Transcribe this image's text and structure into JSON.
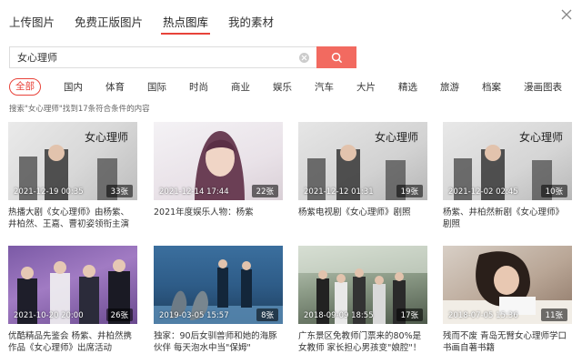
{
  "tabs": [
    {
      "label": "上传图片",
      "active": false
    },
    {
      "label": "免费正版图片",
      "active": false
    },
    {
      "label": "热点图库",
      "active": true
    },
    {
      "label": "我的素材",
      "active": false
    }
  ],
  "search": {
    "value": "女心理师"
  },
  "categories": [
    {
      "label": "全部",
      "active": true
    },
    {
      "label": "国内"
    },
    {
      "label": "体育"
    },
    {
      "label": "国际"
    },
    {
      "label": "时尚"
    },
    {
      "label": "商业"
    },
    {
      "label": "娱乐"
    },
    {
      "label": "汽车"
    },
    {
      "label": "大片"
    },
    {
      "label": "精选"
    },
    {
      "label": "旅游"
    },
    {
      "label": "档案"
    },
    {
      "label": "漫画图表"
    }
  ],
  "result_note": "搜索\"女心理师\"找到17条符合条件的内容",
  "thumb_overlay_text": "女心理师",
  "cards": [
    {
      "date": "2021-12-19 00:35",
      "count": "33张",
      "caption": "热播大剧《女心理师》由杨紫、井柏然、王嘉、曹初姿领衔主演"
    },
    {
      "date": "2021-12-14 17:44",
      "count": "22张",
      "caption": "2021年度娱乐人物：杨紫"
    },
    {
      "date": "2021-12-12 01:31",
      "count": "19张",
      "caption": "杨紫电视剧《女心理师》剧照"
    },
    {
      "date": "2021-12-02 02:45",
      "count": "10张",
      "caption": "杨紫、井柏然新剧《女心理师》剧照"
    },
    {
      "date": "2021-10-20 20:00",
      "count": "26张",
      "caption": "优酷精品先鉴会 杨紫、井柏然携作品《女心理师》出席活动"
    },
    {
      "date": "2019-03-05 15:57",
      "count": "8张",
      "caption": "独家：90后女驯兽师和她的海豚伙伴 每天泡水中当\"保姆\""
    },
    {
      "date": "2018-09-09 18:55",
      "count": "17张",
      "caption": "广东景区免教师门票来的80%是女教师 家长担心男孩变\"娘腔\"！"
    },
    {
      "date": "2018-07-05 15:36",
      "count": "11张",
      "caption": "残而不废 青岛无臂女心理师学口书画自著书籍"
    }
  ]
}
